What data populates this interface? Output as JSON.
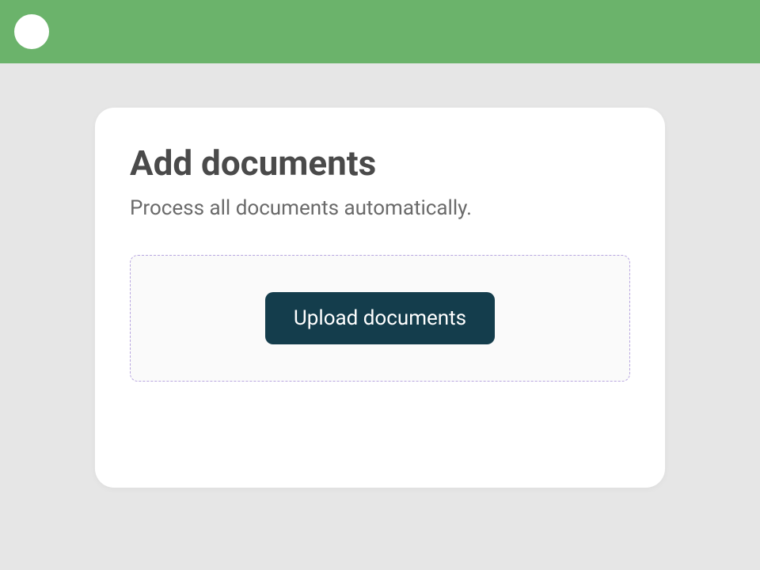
{
  "header": {},
  "card": {
    "title": "Add documents",
    "subtitle": "Process all documents automatically.",
    "upload_button_label": "Upload documents"
  }
}
